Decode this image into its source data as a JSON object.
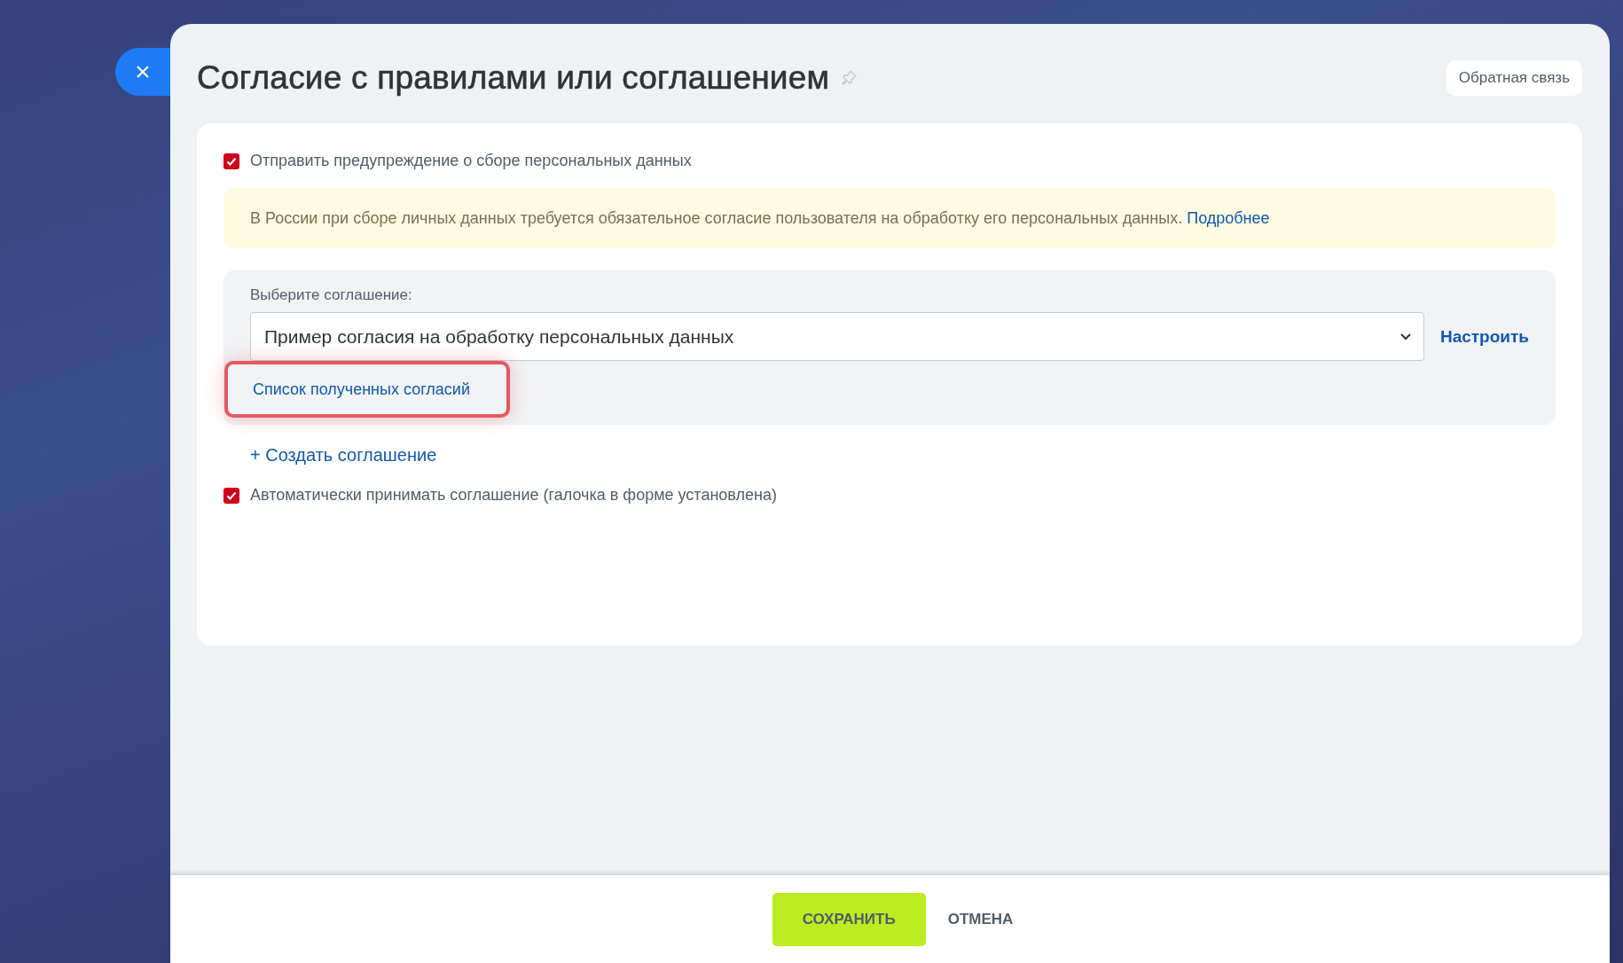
{
  "title": "Согласие с правилами или соглашением",
  "feedback_button": "Обратная связь",
  "warning_checkbox": {
    "label": "Отправить предупреждение о сборе персональных данных",
    "checked": true
  },
  "notice": {
    "text": "В России при сборе личных данных требуется обязательное согласие пользователя на обработку его персональных данных.",
    "link": "Подробнее"
  },
  "agreement": {
    "label": "Выберите соглашение:",
    "value": "Пример согласия на обработку персональных данных",
    "configure_link": "Настроить",
    "consents_link": "Список полученных согласий",
    "highlighted": true
  },
  "create_link": "+ Создать соглашение",
  "auto_accept_checkbox": {
    "label": "Автоматически принимать соглашение (галочка в форме установлена)",
    "checked": true
  },
  "footer": {
    "save": "СОХРАНИТЬ",
    "cancel": "ОТМЕНА"
  }
}
